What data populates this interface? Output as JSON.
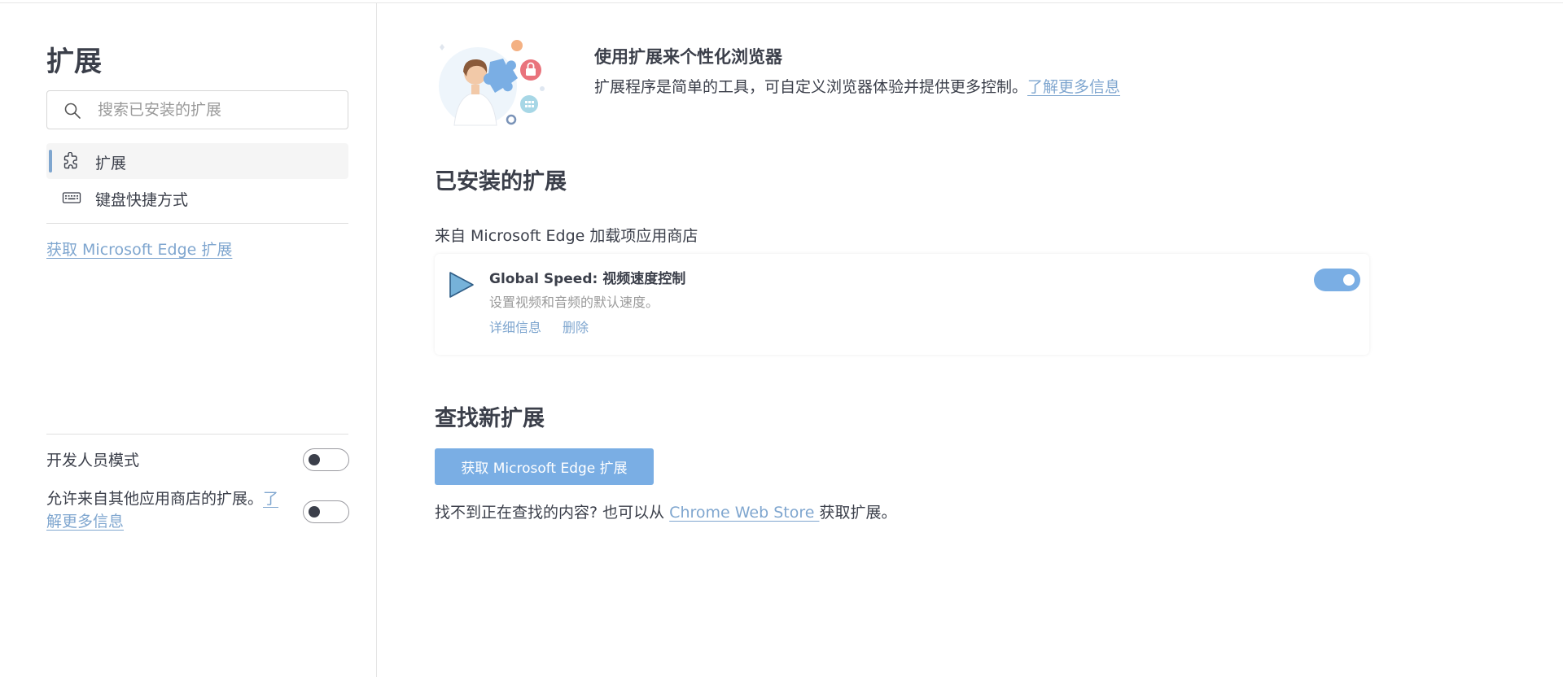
{
  "sidebar": {
    "title": "扩展",
    "search_placeholder": "搜索已安装的扩展",
    "nav": [
      {
        "label": "扩展",
        "icon": "puzzle-icon",
        "active": true
      },
      {
        "label": "键盘快捷方式",
        "icon": "keyboard-icon",
        "active": false
      }
    ],
    "get_extensions_link": "获取 Microsoft Edge 扩展",
    "developer_mode_label": "开发人员模式",
    "other_stores_label": "允许来自其他应用商店的扩展。",
    "other_stores_link": "了解更多信息"
  },
  "hero": {
    "title": "使用扩展来个性化浏览器",
    "description": "扩展程序是简单的工具，可自定义浏览器体验并提供更多控制。",
    "learn_more": "了解更多信息"
  },
  "installed": {
    "title": "已安装的扩展",
    "source_label": "来自 Microsoft Edge 加载项应用商店",
    "extensions": [
      {
        "name": "Global Speed: 视频速度控制",
        "description": "设置视频和音频的默认速度。",
        "details_label": "详细信息",
        "remove_label": "删除",
        "enabled": true
      }
    ]
  },
  "find_new": {
    "title": "查找新扩展",
    "button_label": "获取 Microsoft Edge 扩展",
    "footnote_prefix": "找不到正在查找的内容? 也可以从 ",
    "footnote_link": "Chrome Web Store ",
    "footnote_suffix": "获取扩展。"
  },
  "colors": {
    "accent": "#7aaee4",
    "link": "#7fa6cf",
    "text": "#3b3f4a"
  }
}
